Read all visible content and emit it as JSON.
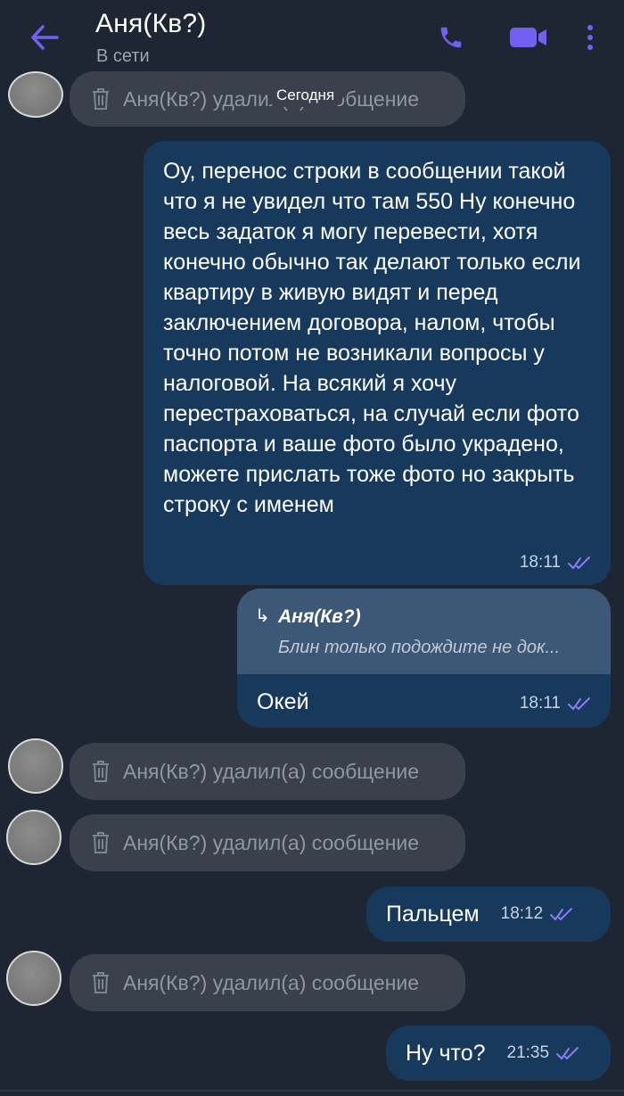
{
  "header": {
    "title": "Аня(Кв?)",
    "status": "В сети"
  },
  "date_chip": "Сегодня",
  "deleted_text": "Аня(Кв?) удалил(а) сообщение",
  "messages": [
    {
      "type": "outgoing",
      "text": "Оу, перенос строки в сообщении такой что я не увидел что там 550 Ну конечно весь задаток я могу перевести, хотя конечно обычно так делают только если квартиру в живую видят и перед заключением договора, налом, чтобы точно потом не возникали вопросы у налоговой. На всякий я хочу перестраховаться, на случай если фото паспорта и ваше фото было украдено, можете прислать тоже фото но закрыть строку с именем",
      "time": "18:11"
    },
    {
      "type": "outgoing_reply",
      "reply_author": "Аня(Кв?)",
      "reply_snippet": "Блин только подождите не док...",
      "text": "Окей",
      "time": "18:11"
    },
    {
      "type": "outgoing",
      "text": "Пальцем",
      "time": "18:12"
    },
    {
      "type": "outgoing",
      "text": "Ну что?",
      "time": "21:35"
    }
  ],
  "colors": {
    "background": "#1f2633",
    "outgoing_bubble": "#17395c",
    "deleted_bubble": "#3a414d",
    "accent": "#7360f2"
  },
  "icons": {
    "back": "arrow-left-icon",
    "call": "phone-icon",
    "video": "video-camera-icon",
    "menu": "more-vertical-icon",
    "trash": "trash-icon",
    "read": "double-check-icon"
  }
}
